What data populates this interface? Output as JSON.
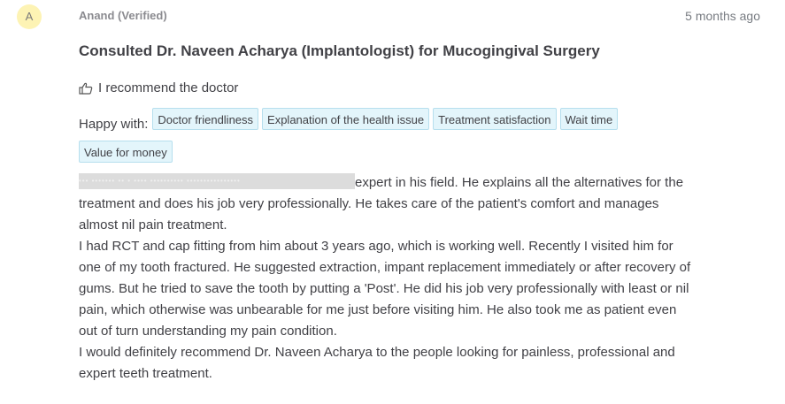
{
  "reviewer": {
    "initial": "A",
    "name": "Anand (Verified)",
    "time": "5 months ago"
  },
  "review": {
    "title": "Consulted Dr. Naveen Acharya (Implantologist) for Mucogingival Surgery",
    "recommend_text": "I recommend the doctor",
    "happy_label": "Happy with:",
    "happy_tags": [
      "Doctor friendliness",
      "Explanation of the health issue",
      "Treatment satisfaction",
      "Wait time",
      "Value for money"
    ],
    "redacted_mask": "••• ••••••• •• • •••• •••••••••• ••••••••••••••••",
    "text_p1_tail": "expert in his field. He explains all the alternatives for the treatment and does his job very professionally. He takes care of the patient's comfort and manages almost nil pain treatment.",
    "text_p2": "I had RCT and cap fitting from him about 3 years ago, which is working well. Recently I visited him for one of my tooth fractured. He suggested extraction, impant replacement immediately or after recovery of gums. But he tried to save the tooth by putting a 'Post'. He did his job very professionally with least or nil pain, which otherwise was unbearable for me just before visiting him. He also took me as patient even out of turn understanding my pain condition.",
    "text_p3": "I would definitely recommend Dr. Naveen Acharya to the people looking for painless, professional and expert teeth treatment."
  },
  "icons": {
    "recommend": "thumbs-up-icon"
  },
  "colors": {
    "avatar_bg": "#fdf3b4",
    "tag_bg": "#e3f5fb",
    "tag_border": "#b6dfee",
    "text": "#414146"
  }
}
